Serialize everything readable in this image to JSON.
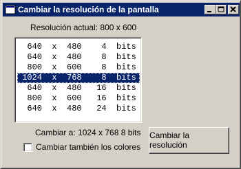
{
  "window": {
    "title": "Cambiar la resolución de la pantalla",
    "icon": "app-window-icon",
    "controls": [
      "minimize-icon",
      "maximize-icon",
      "close-icon"
    ]
  },
  "current_resolution_label": "Resolución actual: 800 x 600",
  "resolutions": [
    "  640  x  480    4  bits",
    "  640  x  480    8  bits",
    "  800  x  600    8  bits",
    " 1024  x  768    8  bits",
    "  640  x  480   16  bits",
    "  800  x  600   16  bits",
    "  640  x  480   24  bits"
  ],
  "selected_index": 3,
  "change_to_label": "Cambiar a: 1024 x 768  8 bits",
  "change_colors_checkbox": {
    "label": "Cambiar también los colores",
    "checked": false
  },
  "apply_button_label": "Cambiar la resolución",
  "colors": {
    "titlebar": "#0a246a",
    "face": "#d4d0c8",
    "selection": "#0a246a"
  }
}
